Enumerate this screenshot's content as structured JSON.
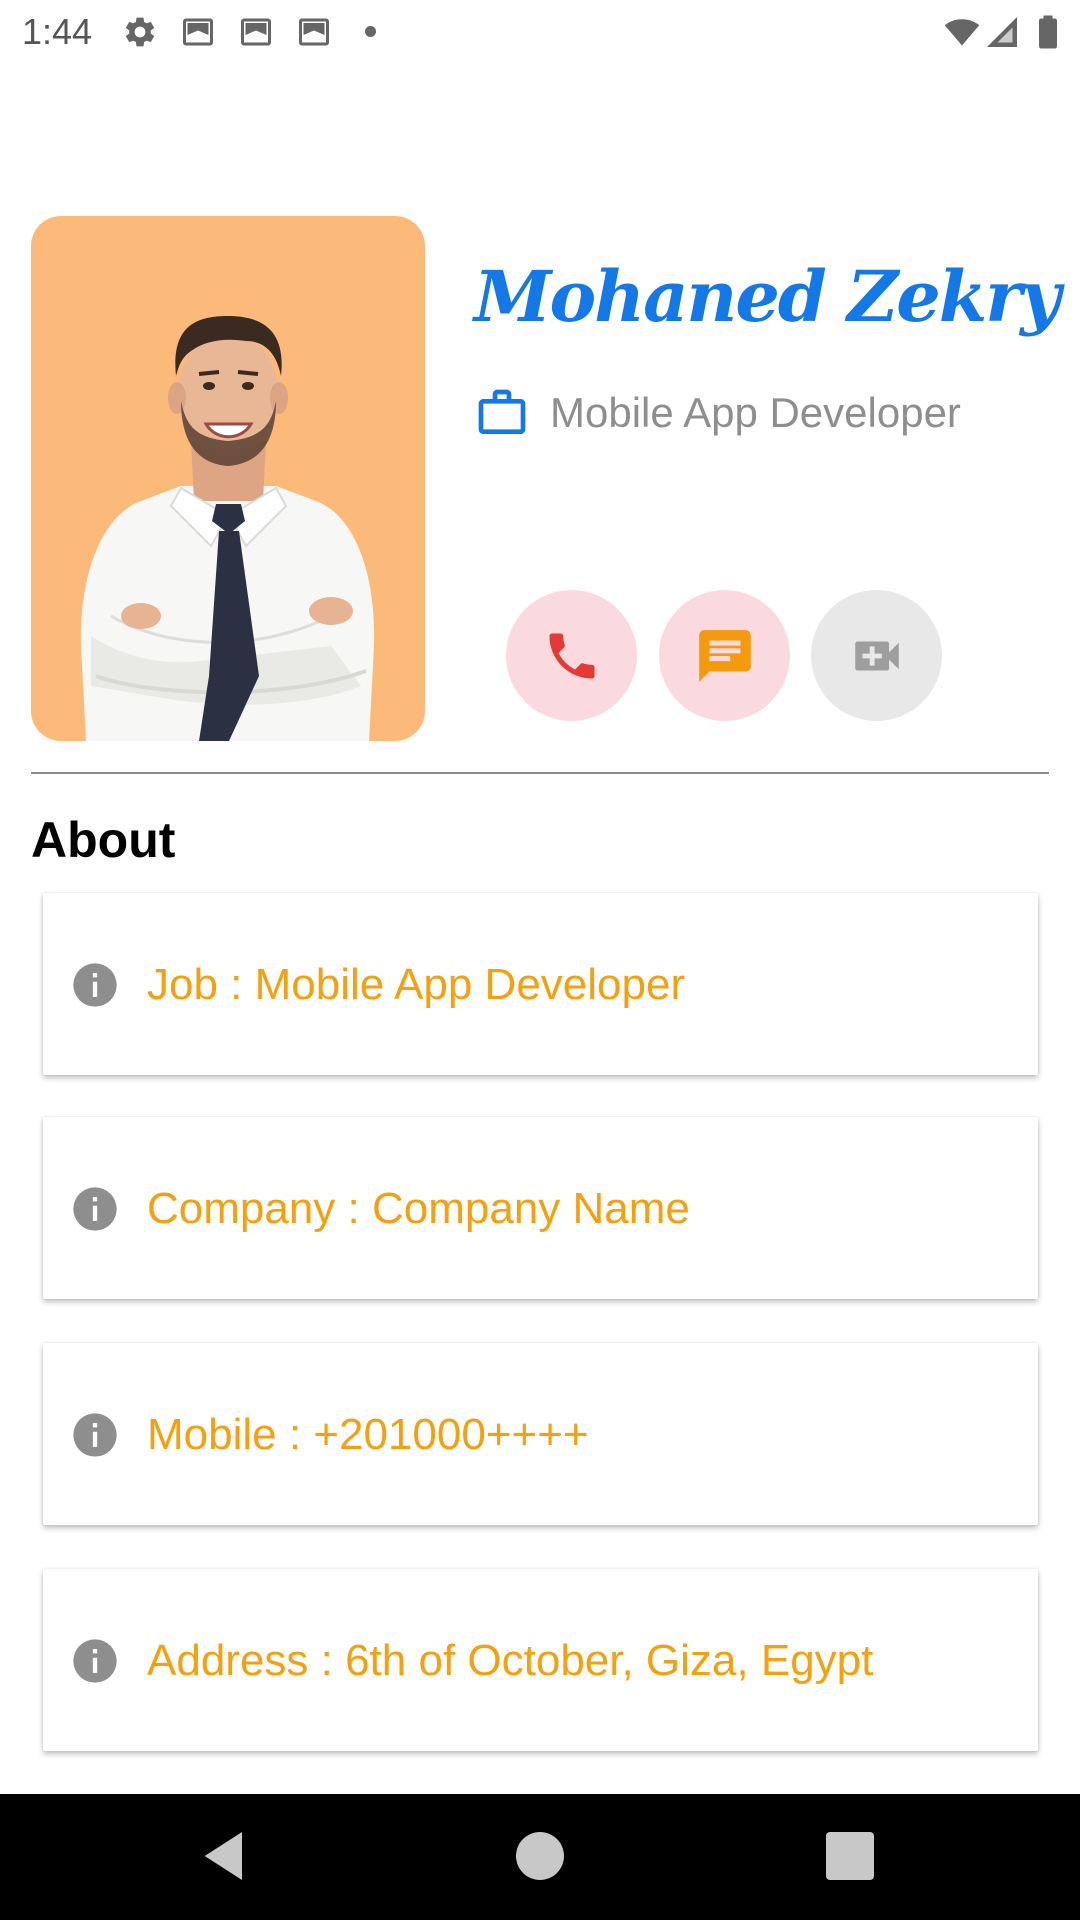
{
  "status_bar": {
    "time": "1:44",
    "icons": [
      "gear-icon",
      "notification-box-icon",
      "notification-box-icon",
      "notification-box-icon",
      "dot-icon",
      "wifi-icon",
      "cell-signal-icon",
      "battery-icon"
    ]
  },
  "profile": {
    "name": "Mohaned Zekry",
    "job": "Mobile App Developer",
    "photo_bg_color": "#FBBA7A",
    "name_color": "#1479E6"
  },
  "actions": [
    {
      "icon": "phone-icon",
      "color": "#E53935"
    },
    {
      "icon": "message-icon",
      "color": "#F59A0C"
    },
    {
      "icon": "video-call-icon",
      "color": "#9E9E9E"
    }
  ],
  "about": {
    "title": "About",
    "text_color": "#F5A00F",
    "items": [
      {
        "text": "Job : Mobile App Developer"
      },
      {
        "text": "Company : Company Name"
      },
      {
        "text": "Mobile : +201000++++"
      },
      {
        "text": "Address : 6th of October, Giza, Egypt"
      }
    ]
  },
  "nav_bar": {
    "buttons": [
      "back-icon",
      "home-icon",
      "recents-icon"
    ]
  }
}
